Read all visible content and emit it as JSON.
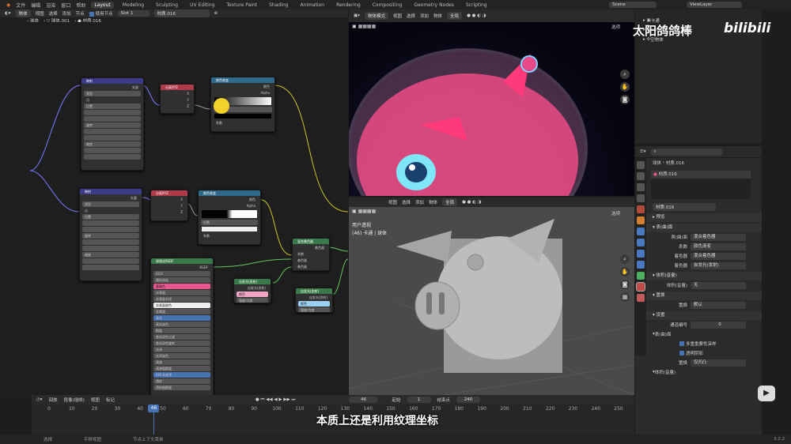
{
  "topbar": {
    "menus": [
      "文件",
      "编辑",
      "渲染",
      "窗口",
      "帮助"
    ],
    "workspaces": [
      "Layout",
      "Modeling",
      "Sculpting",
      "UV Editing",
      "Texture Paint",
      "Shading",
      "Animation",
      "Rendering",
      "Compositing",
      "Geometry Nodes",
      "Scripting"
    ],
    "active_workspace": "Layout",
    "scene": "Scene",
    "view_layer": "ViewLayer"
  },
  "node_editor": {
    "type": "物体",
    "menus": [
      "视图",
      "选择",
      "添加",
      "节点"
    ],
    "use_nodes": "使用节点",
    "slot": "Slot 1",
    "material": "材质.016",
    "breadcrumb": [
      "球体",
      "球体.001",
      "材质.016"
    ]
  },
  "viewport_top": {
    "mode": "物体模式",
    "menus": [
      "视图",
      "选择",
      "添加",
      "物体"
    ],
    "orientation": "全局",
    "options": "选项"
  },
  "viewport_bottom": {
    "menus": [
      "视图",
      "选择",
      "添加",
      "物体"
    ],
    "orientation": "全局",
    "options": "选项",
    "view_name": "用户透视",
    "info": "(46) 卡通 | 球体"
  },
  "outliner": {
    "items": [
      {
        "label": "卡通"
      },
      {
        "label": "mask"
      },
      {
        "label": "空物体"
      }
    ]
  },
  "properties": {
    "breadcrumb": [
      "球体",
      "材质.016"
    ],
    "slot_material": "材质.016",
    "material_name": "材质.016",
    "preview": "预览",
    "surface_section": "表(曲)面",
    "surface_label": "表(曲)面",
    "surface_value": "混合着色器",
    "rows": [
      {
        "label": "系数",
        "value": "颜色渐变"
      },
      {
        "label": "着色器",
        "value": "混合着色器"
      },
      {
        "label": "着色器",
        "value": "自发光(发射)"
      }
    ],
    "volume_section": "体积(音量)",
    "volume_label": "体积(音量)",
    "volume_value": "无",
    "displacement_section": "置换",
    "displacement_label": "置换",
    "displacement_value": "默认",
    "settings_section": "设置",
    "pass_index_label": "通道编号",
    "pass_index_value": "0",
    "surface_sub": "表(曲)面",
    "check1": "多重重要性采样",
    "check2": "透明阴影",
    "displacement2_label": "置换",
    "displacement2_value": "仅凹凸",
    "volume_sub": "体积(音量)"
  },
  "timeline": {
    "menus": [
      "回放",
      "抠像(插帧)",
      "视图",
      "标记"
    ],
    "current_frame": "46",
    "start_label": "起始",
    "start": "1",
    "end_label": "结束点",
    "end": "240",
    "ticks": [
      "0",
      "10",
      "20",
      "30",
      "40",
      "50",
      "60",
      "70",
      "80",
      "90",
      "100",
      "110",
      "120",
      "130",
      "140",
      "150",
      "160",
      "170",
      "180",
      "190",
      "200",
      "210",
      "220",
      "230",
      "240",
      "250"
    ]
  },
  "nodes": [
    {
      "title": "映射",
      "rows": [
        "矢量",
        "类型",
        "点",
        "位置",
        "旋转",
        "缩放"
      ]
    },
    {
      "title": "分离XYZ",
      "rows": [
        "X",
        "Y",
        "Z",
        "矢量"
      ]
    },
    {
      "title": "颜色渐变",
      "rows": [
        "颜色",
        "Alpha",
        "RGB",
        "位置",
        "系数"
      ]
    },
    {
      "title": "映射",
      "rows": [
        "矢量",
        "类型",
        "点",
        "位置",
        "旋转",
        "缩放"
      ]
    },
    {
      "title": "分离XYZ",
      "rows": [
        "X",
        "Y",
        "Z",
        "矢量"
      ]
    },
    {
      "title": "颜色渐变",
      "rows": [
        "颜色",
        "Alpha",
        "RGB",
        "位置",
        "系数"
      ]
    },
    {
      "title": "原理化BSDF",
      "rows": [
        "BSDF",
        "GGX",
        "随机游走",
        "基础色",
        "次表面",
        "次表面半径",
        "次表面颜色",
        "金属度",
        "高光",
        "高光染色",
        "糙度",
        "各向异性过滤",
        "各向异性旋转",
        "光泽",
        "光泽染色",
        "清漆",
        "清漆粗糙度",
        "IOR 折射率",
        "透射",
        "透射粗糙度",
        "自发光(发射)"
      ]
    },
    {
      "title": "混合着色器",
      "rows": [
        "着色器",
        "系数",
        "着色器",
        "着色器"
      ]
    },
    {
      "title": "自发光(发射)",
      "rows": [
        "自发光(发射)",
        "颜色",
        "强度/力度"
      ]
    },
    {
      "title": "自发光(发射)",
      "rows": [
        "自发光(发射)",
        "颜色",
        "强度/力度"
      ]
    }
  ],
  "subtitle": "本质上还是利用纹理坐标",
  "watermark": "太阳鸽鸽棒",
  "brand": "bilibili",
  "status": {
    "select": "选择",
    "pan": "平移视图",
    "context_menu": "节点上下文菜单",
    "version": "3.2.2"
  },
  "colors": {
    "accent": "#4772b3",
    "pink": "#e85590",
    "bg": "#1d1d1d"
  }
}
